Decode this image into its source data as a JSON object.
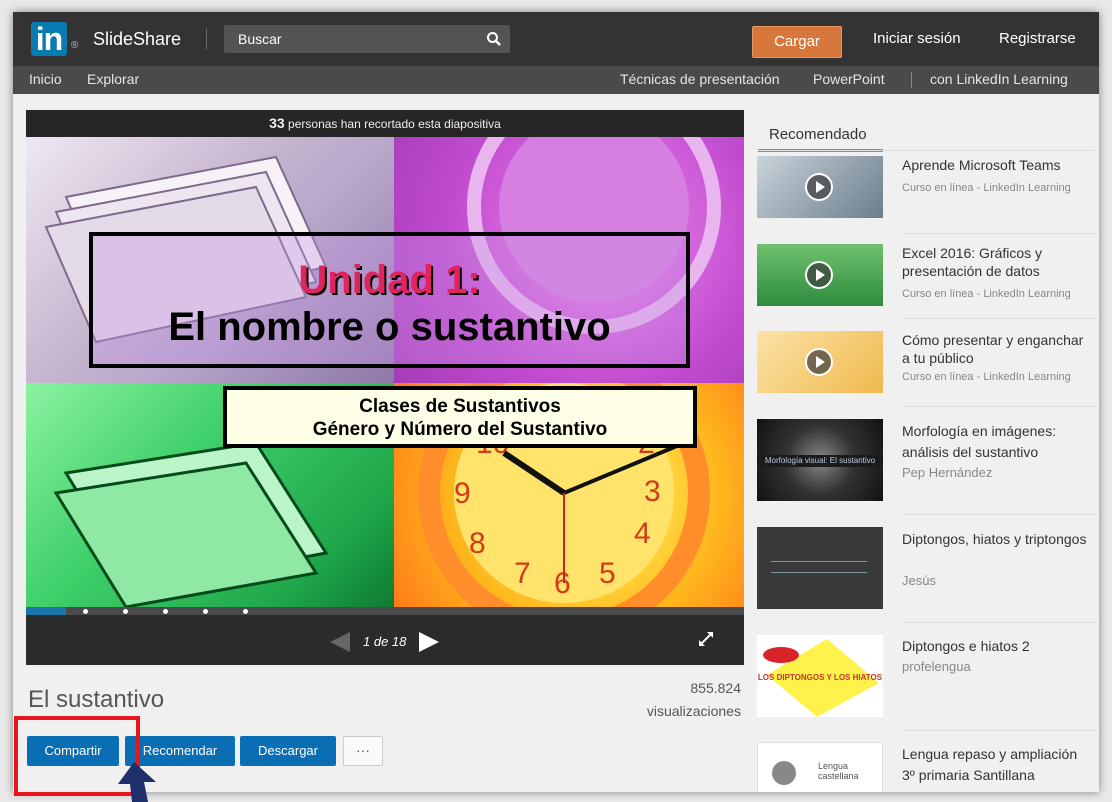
{
  "topbar": {
    "logo_mark": "in",
    "logo_reg": "®",
    "brand": "SlideShare",
    "search_placeholder": "Buscar",
    "upload_label": "Cargar",
    "login_label": "Iniciar sesión",
    "register_label": "Registrarse"
  },
  "subnav": {
    "home": "Inicio",
    "explore": "Explorar",
    "presentation_tech": "Técnicas de presentación",
    "powerpoint": "PowerPoint",
    "linkedin_learning": "con LinkedIn Learning"
  },
  "player": {
    "clipped_count": "33",
    "clipped_text": " personas han recortado esta diapositiva",
    "slide_title_1": "Unidad 1:",
    "slide_title_2": "El nombre o sustantivo",
    "slide_sub_1": "Clases de Sustantivos",
    "slide_sub_2": "Género y Número del Sustantivo",
    "page_indicator": "1 de 18",
    "progress_fraction": 0.056
  },
  "document": {
    "title": "El sustantivo",
    "views_count": "855.824",
    "views_label": "visualizaciones",
    "share_label": "Compartir",
    "like_label": "Recomendar",
    "download_label": "Descargar",
    "more_label": "···"
  },
  "sidebar": {
    "tab_label": "Recomendado",
    "items": [
      {
        "title": "Aprende Microsoft Teams",
        "subtitle": "Curso en línea - LinkedIn Learning",
        "thumb_color": "#8aa0b3"
      },
      {
        "title": "Excel 2016: Gráficos y presentación de datos",
        "subtitle": "Curso en línea - LinkedIn Learning",
        "thumb_color": "#4caf50"
      },
      {
        "title": "Cómo presentar y enganchar a tu público",
        "subtitle": "Curso en línea - LinkedIn Learning",
        "thumb_color": "#f5c86a"
      },
      {
        "title": "Morfología en imágenes: análisis del sustantivo",
        "subtitle": "Pep Hernández",
        "thumb_color": "#333333",
        "thumb_text": "Morfología visual: El sustantivo"
      },
      {
        "title": "Diptongos, hiatos y triptongos",
        "subtitle": "Jesús",
        "thumb_color": "#3a3a3a"
      },
      {
        "title": "Diptongos e hiatos 2",
        "subtitle": "profelengua",
        "thumb_color": "#fff24a",
        "thumb_text": "LOS DIPTONGOS Y LOS HIATOS"
      },
      {
        "title": "Lengua repaso y ampliación 3º primaria Santillana",
        "subtitle": "",
        "thumb_color": "#ffffff",
        "thumb_text": "Lengua castellana"
      }
    ]
  },
  "colors": {
    "topbar": "#333333",
    "upload_button": "#d8773b",
    "action_button": "#0a6eb4",
    "highlight": "#e8141e",
    "pointer": "#1f2f6b"
  }
}
